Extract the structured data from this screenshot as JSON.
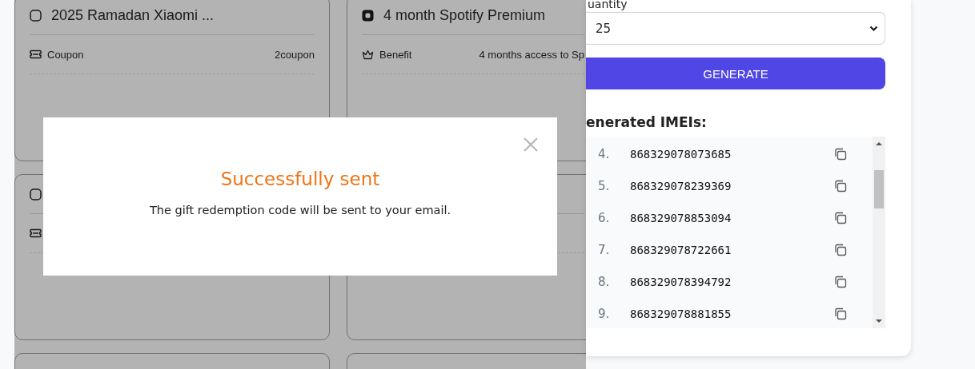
{
  "offers": [
    {
      "title": "2025 Ramadan Xiaomi ...",
      "selected": false,
      "kind": "coupon",
      "kind_label": "Coupon",
      "value": "2coupon"
    },
    {
      "title": "4 month Spotify Premium",
      "selected": true,
      "kind": "benefit",
      "kind_label": "Benefit",
      "value": "4 months access to Sp"
    },
    {
      "selected": false,
      "kind": "coupon"
    }
  ],
  "modal": {
    "title": "Successfully sent",
    "message": "The gift redemption code will be sent to your email."
  },
  "generator": {
    "quantity_label": "uantity",
    "quantity": "25",
    "button": "GENERATE",
    "list_title": "enerated IMEIs:",
    "imeis": [
      {
        "index": "4.",
        "number": "868329078073685"
      },
      {
        "index": "5.",
        "number": "868329078239369"
      },
      {
        "index": "6.",
        "number": "868329078853094"
      },
      {
        "index": "7.",
        "number": "868329078722661"
      },
      {
        "index": "8.",
        "number": "868329078394792"
      },
      {
        "index": "9.",
        "number": "868329078881855"
      }
    ]
  }
}
